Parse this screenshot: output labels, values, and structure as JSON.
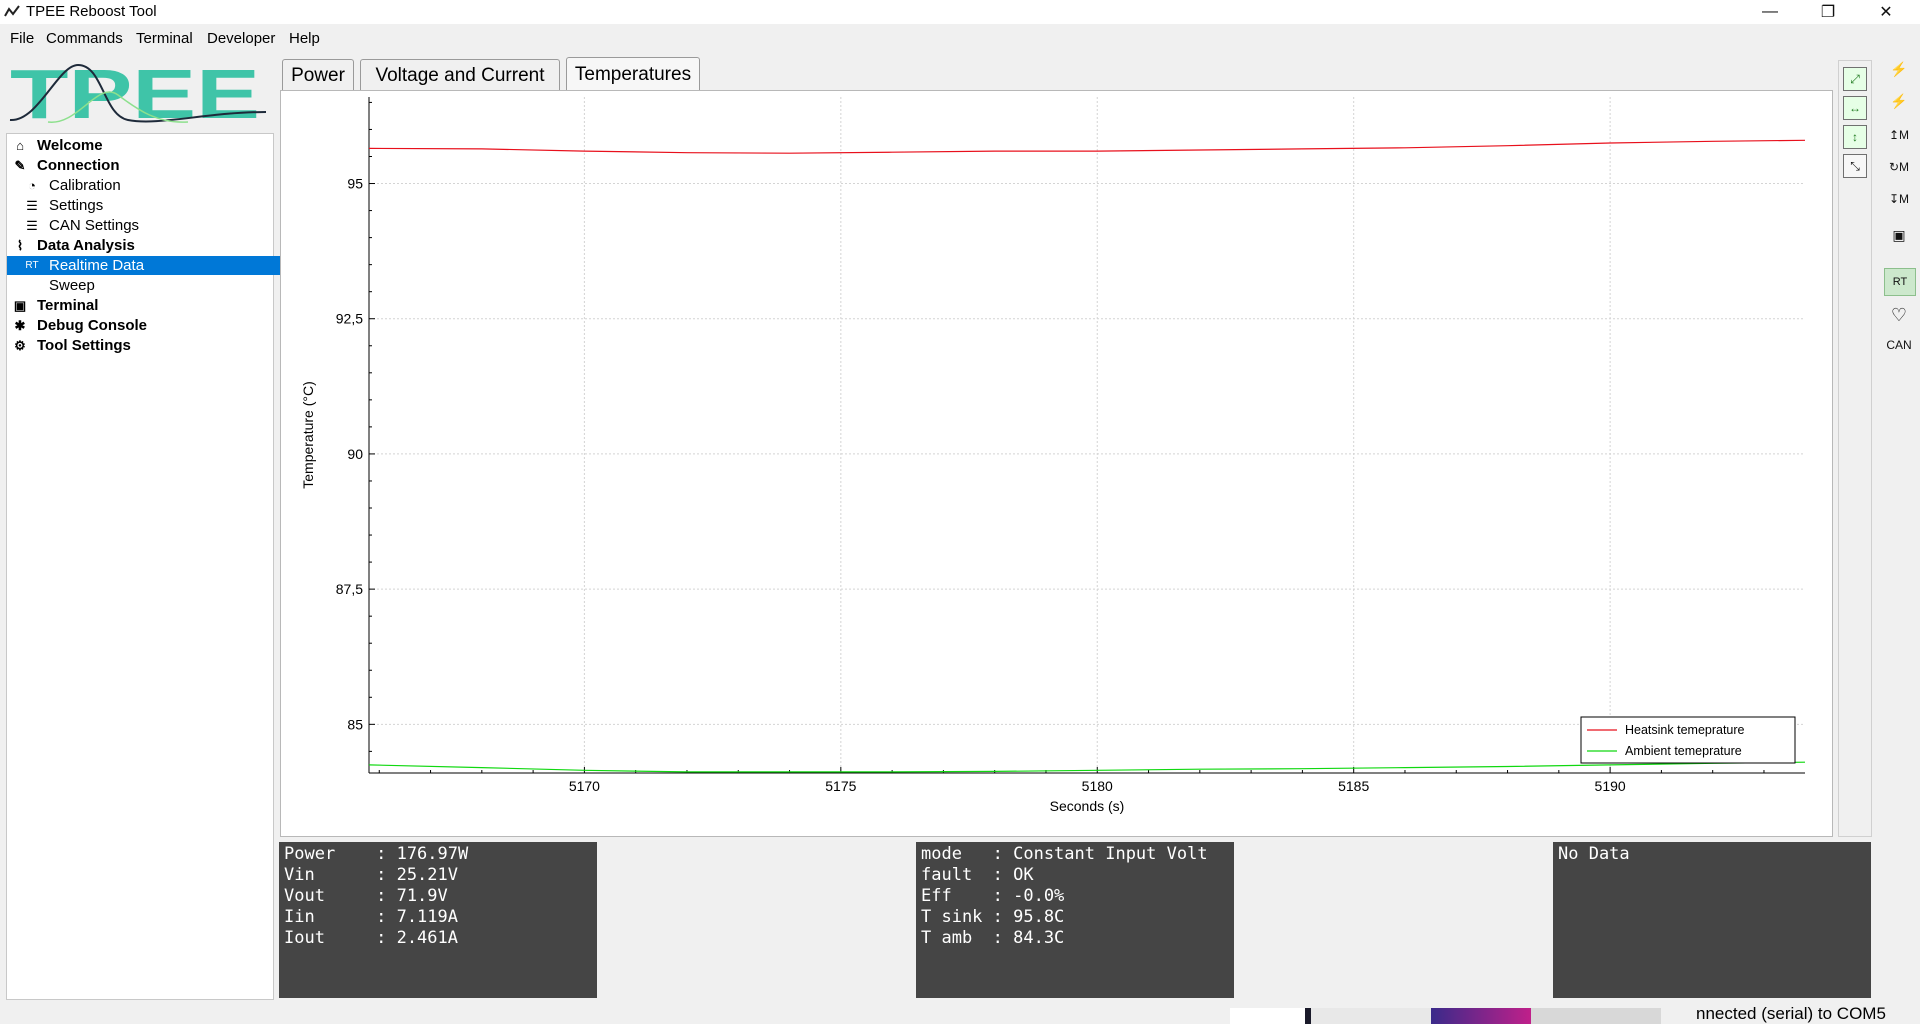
{
  "window": {
    "title": "TPEE Reboost Tool",
    "controls": {
      "minimize": "—",
      "restore": "❐",
      "close": "✕"
    }
  },
  "menu": [
    "File",
    "Commands",
    "Terminal",
    "Developer",
    "Help"
  ],
  "logo": {
    "text": "TPEE"
  },
  "nav": [
    {
      "label": "Welcome",
      "icon": "home-icon",
      "glyph": "⌂",
      "level": 0
    },
    {
      "label": "Connection",
      "icon": "plug-icon",
      "glyph": "✎",
      "level": 0
    },
    {
      "label": "Calibration",
      "icon": "gauge-icon",
      "glyph": "◔",
      "level": 1
    },
    {
      "label": "Settings",
      "icon": "sliders-icon",
      "glyph": "☰",
      "level": 1
    },
    {
      "label": "CAN Settings",
      "icon": "sliders-icon",
      "glyph": "☰",
      "level": 1
    },
    {
      "label": "Data Analysis",
      "icon": "chart-icon",
      "glyph": "⌇",
      "level": 0
    },
    {
      "label": "Realtime Data",
      "icon": "realtime-icon",
      "glyph": "RT",
      "level": 1,
      "selected": true
    },
    {
      "label": "Sweep",
      "icon": "",
      "glyph": "",
      "level": 1
    },
    {
      "label": "Terminal",
      "icon": "terminal-icon",
      "glyph": "▣",
      "level": 0
    },
    {
      "label": "Debug Console",
      "icon": "bug-icon",
      "glyph": "✱",
      "level": 0
    },
    {
      "label": "Tool Settings",
      "icon": "gear-icon",
      "glyph": "⚙",
      "level": 0
    }
  ],
  "tabs": [
    {
      "label": "Power",
      "active": false
    },
    {
      "label": "Voltage and Current",
      "active": false
    },
    {
      "label": "Temperatures",
      "active": true
    }
  ],
  "plot_toolbar": [
    "zoom-fit-icon",
    "zoom-horizontal-icon",
    "zoom-vertical-icon",
    "rescale-icon"
  ],
  "right_toolbar": [
    {
      "icon": "connect-icon",
      "glyph": "⚡"
    },
    {
      "icon": "disconnect-icon",
      "glyph": "⚡"
    },
    {
      "icon": "read-m-icon",
      "glyph": "↥M"
    },
    {
      "icon": "refresh-m-icon",
      "glyph": "↻M"
    },
    {
      "icon": "write-m-icon",
      "glyph": "↧M"
    },
    {
      "icon": "save-icon",
      "glyph": "▣"
    },
    {
      "icon": "realtime-icon",
      "glyph": "RT",
      "selected": true
    },
    {
      "icon": "heart-icon",
      "glyph": "♡"
    },
    {
      "icon": "can-icon",
      "glyph": "CAN"
    }
  ],
  "chart_data": {
    "type": "line",
    "xlabel": "Seconds (s)",
    "ylabel": "Temperature (°C)",
    "xlim": [
      5165.8,
      5193.8
    ],
    "ylim": [
      84.1,
      96.6
    ],
    "x_ticks": [
      "5170",
      "5175",
      "5180",
      "5185",
      "5190"
    ],
    "y_ticks": [
      "95",
      "92,5",
      "90",
      "87,5",
      "85"
    ],
    "grid": true,
    "legend_position": "bottom-right",
    "series": [
      {
        "name": "Heatsink temeprature",
        "color": "#e8101c",
        "x": [
          5165.8,
          5168,
          5170,
          5172,
          5174,
          5176,
          5178,
          5180,
          5182,
          5184,
          5186,
          5188,
          5190,
          5192,
          5193.8
        ],
        "values": [
          95.65,
          95.64,
          95.6,
          95.57,
          95.56,
          95.58,
          95.6,
          95.6,
          95.62,
          95.64,
          95.66,
          95.7,
          95.75,
          95.78,
          95.8
        ]
      },
      {
        "name": "Ambient temeprature",
        "color": "#10d810",
        "x": [
          5165.8,
          5168,
          5170,
          5172,
          5174,
          5176,
          5178,
          5180,
          5182,
          5184,
          5186,
          5188,
          5190,
          5192,
          5193.8
        ],
        "values": [
          84.25,
          84.2,
          84.15,
          84.12,
          84.12,
          84.12,
          84.13,
          84.15,
          84.17,
          84.18,
          84.2,
          84.22,
          84.25,
          84.28,
          84.3
        ]
      }
    ]
  },
  "consoles": [
    {
      "lines": [
        "Power    : 176.97W",
        "Vin      : 25.21V",
        "Vout     : 71.9V",
        "Iin      : 7.119A",
        "Iout     : 2.461A"
      ]
    },
    {
      "lines": [
        "mode   : Constant Input Volt",
        "fault  : OK",
        "Eff    : -0.0%",
        "T sink : 95.8C",
        "T amb  : 84.3C"
      ]
    },
    {
      "lines": [
        "No Data"
      ]
    }
  ],
  "status": {
    "text": "nnected (serial) to COM5"
  },
  "colors": {
    "selection": "#0078d7",
    "console_bg": "#454545",
    "logo_teal": "#3fc4a8"
  }
}
